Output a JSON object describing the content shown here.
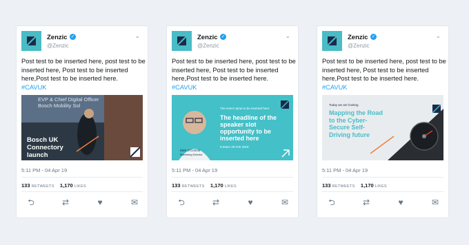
{
  "tweets": [
    {
      "name": "Zenzic",
      "handle": "@Zenzic",
      "text": "Post test to be inserted here, post test to be inserted here, Post test to be inserted here,Post test to be inserted here.",
      "hashtag": "#CAVUK",
      "time": "5:11 PM - 04 Apr 19",
      "retweets": "133",
      "retweets_label": "RETWEETS",
      "likes": "1,170",
      "likes_label": "LIKES",
      "media": {
        "screen_text": "EVP & Chief Digital Officer\nBosch Mobility Sol",
        "headline": "Bosch UK Connectory launch"
      }
    },
    {
      "name": "Zenzic",
      "handle": "@Zenzic",
      "text": "Post test to be inserted here, post test to be inserted here, Post test to be inserted here,Post test to be inserted here.",
      "hashtag": "#CAVUK",
      "time": "5:11 PM - 04 Apr 19",
      "retweets": "133",
      "retweets_label": "RETWEETS",
      "likes": "1,170",
      "likes_label": "LIKES",
      "media": {
        "kicker": "The event name to be inserted here",
        "headline": "The headline of the speaker slot opportunity to be inserted here",
        "date": "9:30am 28 Feb 2019",
        "speaker": "Mick O'Connor",
        "speaker_role": "Marketing Director"
      }
    },
    {
      "name": "Zenzic",
      "handle": "@Zenzic",
      "text": "Post test to be inserted here, post test to be inserted here, Post test to be inserted here,Post test to be inserted here.",
      "hashtag": "#CAVUK",
      "time": "5:11 PM - 04 Apr 19",
      "retweets": "133",
      "retweets_label": "RETWEETS",
      "likes": "1,170",
      "likes_label": "LIKES",
      "media": {
        "kicker": "Today we are hosting",
        "headline": "Mapping the Road to the Cyber- Secure Self-Driving future"
      }
    }
  ],
  "icons": [
    "verified-badge-icon",
    "chevron-down-icon",
    "reply-icon",
    "retweet-icon",
    "like-icon",
    "message-icon",
    "zenzic-logo"
  ],
  "colors": {
    "brand_teal": "#49bcc6",
    "link": "#1da1f2",
    "accent_orange": "#f0803c"
  }
}
